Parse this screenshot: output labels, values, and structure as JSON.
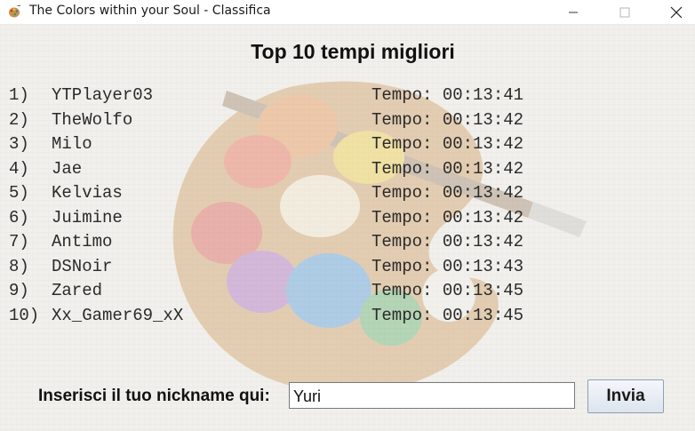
{
  "window": {
    "title": "The Colors within your Soul - Classifica",
    "app_icon": "palette-icon",
    "controls": [
      "minimize-icon",
      "maximize-icon",
      "close-icon"
    ]
  },
  "heading": "Top 10 tempi migliori",
  "leaderboard": [
    {
      "rank": "1)",
      "name": "YTPlayer03",
      "time": "Tempo: 00:13:41"
    },
    {
      "rank": "2)",
      "name": "TheWolfo",
      "time": "Tempo: 00:13:42"
    },
    {
      "rank": "3)",
      "name": "Milo",
      "time": "Tempo: 00:13:42"
    },
    {
      "rank": "4)",
      "name": "Jae",
      "time": "Tempo: 00:13:42"
    },
    {
      "rank": "5)",
      "name": "Kelvias",
      "time": "Tempo: 00:13:42"
    },
    {
      "rank": "6)",
      "name": "Juimine",
      "time": "Tempo: 00:13:42"
    },
    {
      "rank": "7)",
      "name": "Antimo",
      "time": "Tempo: 00:13:42"
    },
    {
      "rank": "8)",
      "name": "DSNoir",
      "time": "Tempo: 00:13:43"
    },
    {
      "rank": "9)",
      "name": "Zared",
      "time": "Tempo: 00:13:45"
    },
    {
      "rank": "10)",
      "name": "Xx_Gamer69_xX",
      "time": "Tempo: 00:13:45"
    }
  ],
  "nickname": {
    "label": "Inserisci il tuo nickname qui:",
    "value": "Yuri",
    "button": "Invia"
  },
  "background_icon": "palette-watermark-icon"
}
